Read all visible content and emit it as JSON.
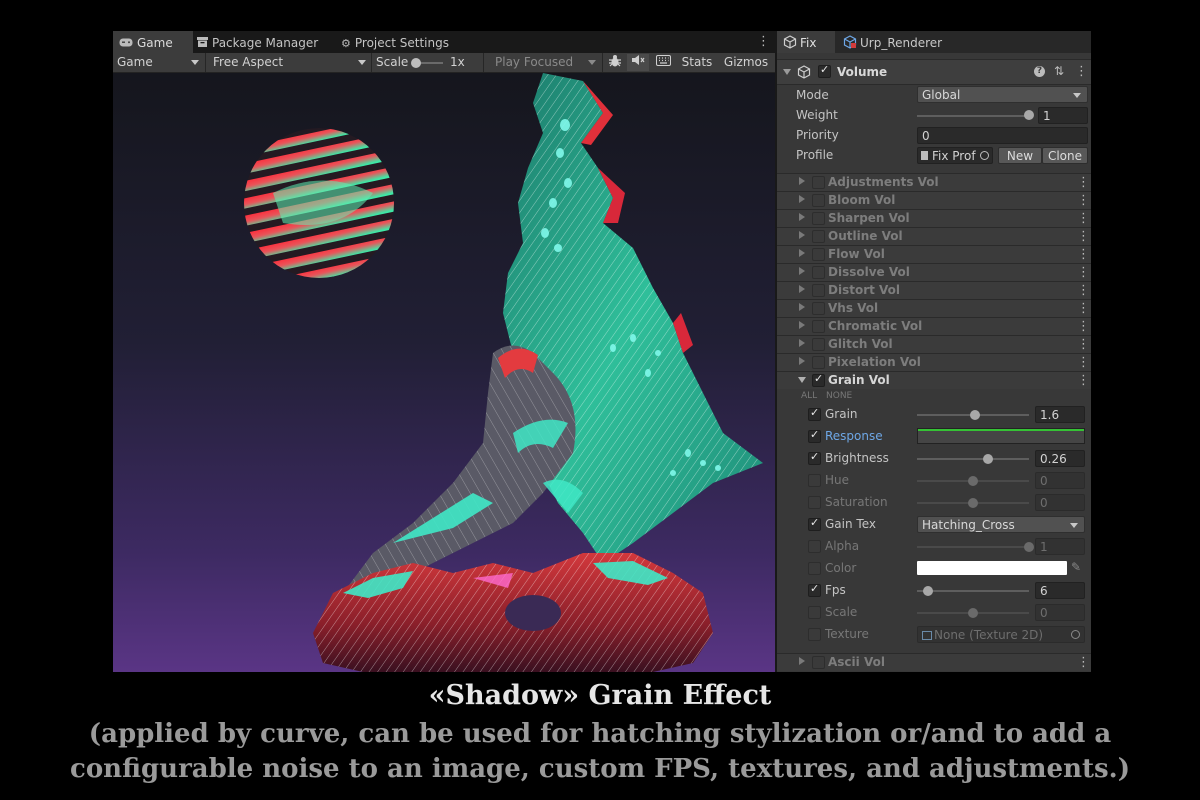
{
  "game_view": {
    "tabs": [
      {
        "label": "Game",
        "icon": "gamepad-icon"
      },
      {
        "label": "Package Manager",
        "icon": "package-icon"
      },
      {
        "label": "Project Settings",
        "icon": "gear-icon"
      }
    ],
    "toolbar": {
      "display": "Game",
      "aspect": "Free Aspect",
      "scale_label": "Scale",
      "scale_value": "1x",
      "scale_fraction": 0.1,
      "play_mode": "Play Focused",
      "stats": "Stats",
      "gizmos": "Gizmos"
    }
  },
  "inspector": {
    "tabs": [
      {
        "label": "Fix",
        "icon": "cube-icon"
      },
      {
        "label": "Urp_Renderer",
        "icon": "cube-icon"
      }
    ],
    "component": {
      "name": "Volume",
      "enabled": true,
      "mode_label": "Mode",
      "mode_value": "Global",
      "weight_label": "Weight",
      "weight_value": "1",
      "weight_fraction": 1.0,
      "priority_label": "Priority",
      "priority_value": "0",
      "profile_label": "Profile",
      "profile_value": "Fix Prof",
      "new_label": "New",
      "clone_label": "Clone"
    },
    "collapsed_volumes": [
      "Adjustments Vol",
      "Bloom Vol",
      "Sharpen Vol",
      "Outline Vol",
      "Flow Vol",
      "Dissolve Vol",
      "Distort Vol",
      "Vhs Vol",
      "Chromatic Vol",
      "Glitch Vol",
      "Pixelation Vol"
    ],
    "grain": {
      "name": "Grain Vol",
      "all_label": "ALL",
      "none_label": "NONE",
      "props": [
        {
          "label": "Grain",
          "checked": true,
          "type": "slider",
          "value": "1.6",
          "fraction": 0.52
        },
        {
          "label": "Response",
          "checked": true,
          "type": "curve",
          "highlight": true
        },
        {
          "label": "Brightness",
          "checked": true,
          "type": "slider",
          "value": "0.26",
          "fraction": 0.63
        },
        {
          "label": "Hue",
          "checked": false,
          "type": "slider",
          "value": "0",
          "fraction": 0.5
        },
        {
          "label": "Saturation",
          "checked": false,
          "type": "slider",
          "value": "0",
          "fraction": 0.5
        },
        {
          "label": "Gain Tex",
          "checked": true,
          "type": "dropdown",
          "value": "Hatching_Cross"
        },
        {
          "label": "Alpha",
          "checked": false,
          "type": "slider",
          "value": "1",
          "fraction": 1.0
        },
        {
          "label": "Color",
          "checked": false,
          "type": "color",
          "value": "#ffffff"
        },
        {
          "label": "Fps",
          "checked": true,
          "type": "slider",
          "value": "6",
          "fraction": 0.1
        },
        {
          "label": "Scale",
          "checked": false,
          "type": "slider",
          "value": "0",
          "fraction": 0.5
        },
        {
          "label": "Texture",
          "checked": false,
          "type": "object",
          "value": "None (Texture 2D)"
        }
      ]
    },
    "after_volumes": [
      "Ascii Vol"
    ]
  },
  "caption": {
    "title": "«Shadow» Grain Effect",
    "line1": "(applied by curve, can be used for hatching stylization or/and to add a",
    "line2": "configurable noise to an image, custom FPS, textures, and adjustments.)"
  }
}
